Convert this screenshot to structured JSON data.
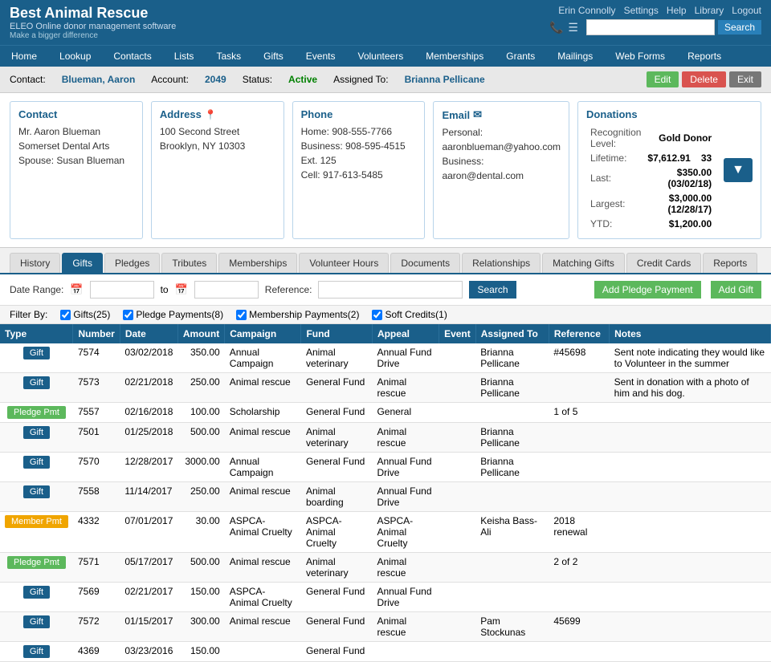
{
  "header": {
    "app_name": "Best Animal Rescue",
    "subtitle": "ELEO Online donor management software",
    "tagline": "Make a bigger difference",
    "nav_links": [
      "Home",
      "Lookup",
      "Contacts",
      "Lists",
      "Tasks",
      "Gifts",
      "Events",
      "Volunteers",
      "Memberships",
      "Grants",
      "Mailings",
      "Web Forms",
      "Reports"
    ],
    "user_links": [
      "Erin Connolly",
      "Settings",
      "Help",
      "Library",
      "Logout"
    ],
    "search_placeholder": ""
  },
  "contact_bar": {
    "contact_label": "Contact:",
    "contact_value": "Blueman, Aaron",
    "account_label": "Account:",
    "account_value": "2049",
    "status_label": "Status:",
    "status_value": "Active",
    "assigned_label": "Assigned To:",
    "assigned_value": "Brianna Pellicane",
    "btn_edit": "Edit",
    "btn_delete": "Delete",
    "btn_exit": "Exit"
  },
  "info": {
    "contact": {
      "title": "Contact",
      "line1": "Mr. Aaron Blueman",
      "line2": "Somerset Dental Arts",
      "line3": "Spouse: Susan Blueman"
    },
    "address": {
      "title": "Address",
      "line1": "100 Second Street",
      "line2": "Brooklyn, NY 10303"
    },
    "phone": {
      "title": "Phone",
      "home_label": "Home:",
      "home_value": "908-555-7766",
      "business_label": "Business:",
      "business_value": "908-595-4515 Ext. 125",
      "cell_label": "Cell:",
      "cell_value": "917-613-5485"
    },
    "email": {
      "title": "Email",
      "personal_label": "Personal:",
      "personal_value": "aaronblueman@yahoo.com",
      "business_label": "Business:",
      "business_value": "aaron@dental.com"
    },
    "donations": {
      "title": "Donations",
      "recognition_label": "Recognition Level:",
      "recognition_value": "Gold Donor",
      "lifetime_label": "Lifetime:",
      "lifetime_value": "$7,612.91",
      "lifetime_count": "33",
      "last_label": "Last:",
      "last_value": "$350.00 (03/02/18)",
      "largest_label": "Largest:",
      "largest_value": "$3,000.00 (12/28/17)",
      "ytd_label": "YTD:",
      "ytd_value": "$1,200.00"
    }
  },
  "tabs": [
    "History",
    "Gifts",
    "Pledges",
    "Tributes",
    "Memberships",
    "Volunteer Hours",
    "Documents",
    "Relationships",
    "Matching Gifts",
    "Credit Cards",
    "Reports"
  ],
  "active_tab": "Gifts",
  "filter": {
    "date_range_label": "Date Range:",
    "to_label": "to",
    "reference_label": "Reference:",
    "search_btn": "Search",
    "add_pledge_btn": "Add Pledge Payment",
    "add_gift_btn": "Add Gift"
  },
  "checkboxes": [
    {
      "label": "Gifts(25)",
      "checked": true
    },
    {
      "label": "Pledge Payments(8)",
      "checked": true
    },
    {
      "label": "Membership Payments(2)",
      "checked": true
    },
    {
      "label": "Soft Credits(1)",
      "checked": true
    }
  ],
  "filter_by_label": "Filter By:",
  "table": {
    "columns": [
      "Type",
      "Number",
      "Date",
      "Amount",
      "Campaign",
      "Fund",
      "Appeal",
      "Event",
      "Assigned To",
      "Reference",
      "Notes"
    ],
    "rows": [
      {
        "type": "Gift",
        "type_class": "type-gift",
        "number": "7574",
        "date": "03/02/2018",
        "amount": "350.00",
        "campaign": "Annual Campaign",
        "fund": "Animal veterinary",
        "appeal": "Annual Fund Drive",
        "event": "",
        "assigned_to": "Brianna Pellicane",
        "reference": "#45698",
        "notes": "Sent note indicating they would like to Volunteer in the summer"
      },
      {
        "type": "Gift",
        "type_class": "type-gift",
        "number": "7573",
        "date": "02/21/2018",
        "amount": "250.00",
        "campaign": "Animal rescue",
        "fund": "General Fund",
        "appeal": "Animal rescue",
        "event": "",
        "assigned_to": "Brianna Pellicane",
        "reference": "",
        "notes": "Sent in donation with a photo of him and his dog."
      },
      {
        "type": "Pledge Pmt",
        "type_class": "type-pledge",
        "number": "7557",
        "date": "02/16/2018",
        "amount": "100.00",
        "campaign": "Scholarship",
        "fund": "General Fund",
        "appeal": "General",
        "event": "",
        "assigned_to": "",
        "reference": "1 of 5",
        "notes": ""
      },
      {
        "type": "Gift",
        "type_class": "type-gift",
        "number": "7501",
        "date": "01/25/2018",
        "amount": "500.00",
        "campaign": "Animal rescue",
        "fund": "Animal veterinary",
        "appeal": "Animal rescue",
        "event": "",
        "assigned_to": "Brianna Pellicane",
        "reference": "",
        "notes": ""
      },
      {
        "type": "Gift",
        "type_class": "type-gift",
        "number": "7570",
        "date": "12/28/2017",
        "amount": "3000.00",
        "campaign": "Annual Campaign",
        "fund": "General Fund",
        "appeal": "Annual Fund Drive",
        "event": "",
        "assigned_to": "Brianna Pellicane",
        "reference": "",
        "notes": ""
      },
      {
        "type": "Gift",
        "type_class": "type-gift",
        "number": "7558",
        "date": "11/14/2017",
        "amount": "250.00",
        "campaign": "Animal rescue",
        "fund": "Animal boarding",
        "appeal": "Annual Fund Drive",
        "event": "",
        "assigned_to": "",
        "reference": "",
        "notes": ""
      },
      {
        "type": "Member Pmt",
        "type_class": "type-member",
        "number": "4332",
        "date": "07/01/2017",
        "amount": "30.00",
        "campaign": "ASPCA- Animal Cruelty",
        "fund": "ASPCA- Animal Cruelty",
        "appeal": "ASPCA- Animal Cruelty",
        "event": "",
        "assigned_to": "Keisha Bass-Ali",
        "reference": "2018 renewal",
        "notes": ""
      },
      {
        "type": "Pledge Pmt",
        "type_class": "type-pledge",
        "number": "7571",
        "date": "05/17/2017",
        "amount": "500.00",
        "campaign": "Animal rescue",
        "fund": "Animal veterinary",
        "appeal": "Animal rescue",
        "event": "",
        "assigned_to": "",
        "reference": "2 of 2",
        "notes": ""
      },
      {
        "type": "Gift",
        "type_class": "type-gift",
        "number": "7569",
        "date": "02/21/2017",
        "amount": "150.00",
        "campaign": "ASPCA- Animal Cruelty",
        "fund": "General Fund",
        "appeal": "Annual Fund Drive",
        "event": "",
        "assigned_to": "",
        "reference": "",
        "notes": ""
      },
      {
        "type": "Gift",
        "type_class": "type-gift",
        "number": "7572",
        "date": "01/15/2017",
        "amount": "300.00",
        "campaign": "Animal rescue",
        "fund": "General Fund",
        "appeal": "Animal rescue",
        "event": "",
        "assigned_to": "Pam Stockunas",
        "reference": "45699",
        "notes": ""
      },
      {
        "type": "Gift",
        "type_class": "type-gift",
        "number": "4369",
        "date": "03/23/2016",
        "amount": "150.00",
        "campaign": "",
        "fund": "General Fund",
        "appeal": "",
        "event": "",
        "assigned_to": "",
        "reference": "",
        "notes": ""
      }
    ]
  }
}
